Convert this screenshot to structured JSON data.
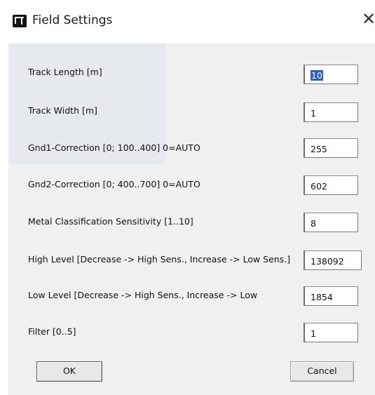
{
  "window": {
    "title": "Field Settings",
    "close_glyph": "✕",
    "icon": "app-logo-icon"
  },
  "fields": [
    {
      "label": "Track Length [m]",
      "value": "10",
      "selected": true
    },
    {
      "label": "Track Width [m]",
      "value": "1"
    },
    {
      "label": "Gnd1-Correction [0; 100..400]  0=AUTO",
      "value": "255"
    },
    {
      "label": "Gnd2-Correction [0; 400..700]  0=AUTO",
      "value": "602"
    },
    {
      "label": "Metal Classification Sensitivity [1..10]",
      "value": "8"
    },
    {
      "label": "High Level  [Decrease -> High Sens., Increase -> Low Sens.]",
      "value": "138092"
    },
    {
      "label": "Low Level   [Decrease -> High Sens., Increase -> Low",
      "value": "1854"
    },
    {
      "label": "Filter  [0..5]",
      "value": "1"
    }
  ],
  "buttons": {
    "ok": "OK",
    "cancel": "Cancel"
  },
  "colors": {
    "dialog_background": "#f0f0f0",
    "selection_highlight": "#2f5fbf"
  }
}
